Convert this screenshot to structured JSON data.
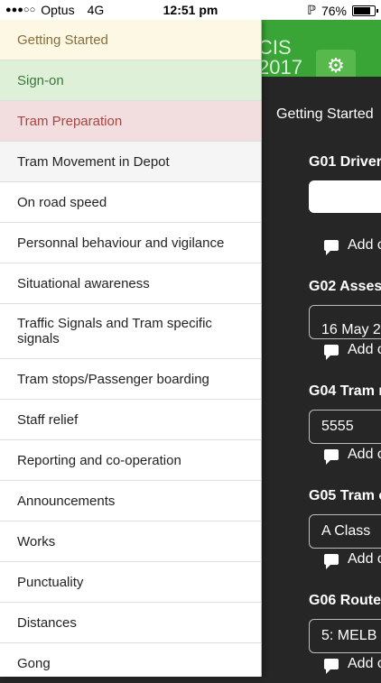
{
  "status_bar": {
    "carrier": "Optus",
    "network": "4G",
    "time": "12:51 pm",
    "battery": "76%"
  },
  "header": {
    "title": "CIS\n2017"
  },
  "content": {
    "section_title": "Getting Started",
    "fields": [
      {
        "label": "G01 Driver",
        "value": ""
      },
      {
        "label": "G02 Assess",
        "value": "16 May 2"
      },
      {
        "label": "G04 Tram n",
        "value": "5555"
      },
      {
        "label": "G05 Tram c",
        "value": "A Class"
      },
      {
        "label": "G06 Route",
        "value": "5: MELB U"
      }
    ],
    "add_comment": "Add c"
  },
  "drawer": {
    "items": [
      {
        "label": "Getting Started"
      },
      {
        "label": "Sign-on"
      },
      {
        "label": "Tram Preparation"
      },
      {
        "label": "Tram Movement in Depot"
      },
      {
        "label": "On road speed"
      },
      {
        "label": "Personnal behaviour and vigilance"
      },
      {
        "label": "Situational awareness"
      },
      {
        "label": "Traffic Signals and Tram specific signals"
      },
      {
        "label": "Tram stops/Passenger boarding"
      },
      {
        "label": "Staff relief"
      },
      {
        "label": "Reporting and co-operation"
      },
      {
        "label": "Announcements"
      },
      {
        "label": "Works"
      },
      {
        "label": "Punctuality"
      },
      {
        "label": "Distances"
      },
      {
        "label": "Gong"
      }
    ]
  },
  "colors": {
    "header_green": "#3aa537",
    "warning_bg": "#fcf8e3",
    "success_bg": "#dff0d8",
    "danger_bg": "#f2dede"
  }
}
